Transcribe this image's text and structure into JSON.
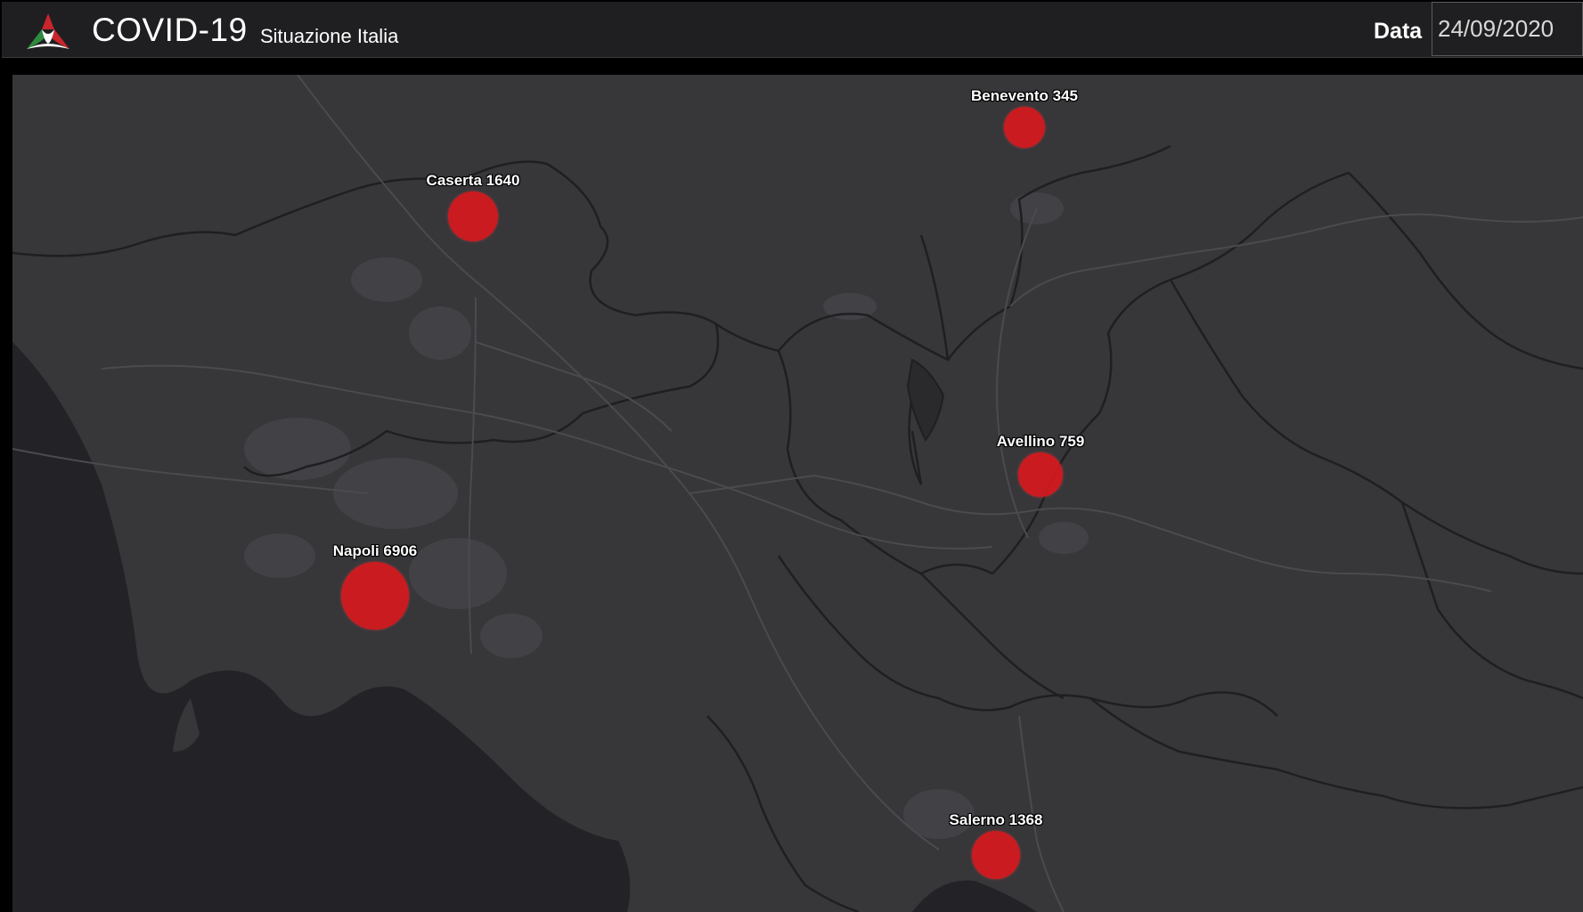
{
  "header": {
    "title": "COVID-19",
    "subtitle": "Situazione Italia",
    "date_label": "Data",
    "date_value": "24/09/2020",
    "logo_icon": "protezione-civile-logo-icon"
  },
  "map": {
    "background_color": "#37373a",
    "sea_color": "#232327",
    "marker_color": "#d7191e",
    "markers": [
      {
        "name": "Caserta",
        "value": 1640,
        "label": "Caserta 1640"
      },
      {
        "name": "Benevento",
        "value": 345,
        "label": "Benevento 345"
      },
      {
        "name": "Avellino",
        "value": 759,
        "label": "Avellino 759"
      },
      {
        "name": "Napoli",
        "value": 6906,
        "label": "Napoli 6906"
      },
      {
        "name": "Salerno",
        "value": 1368,
        "label": "Salerno 1368"
      }
    ]
  }
}
